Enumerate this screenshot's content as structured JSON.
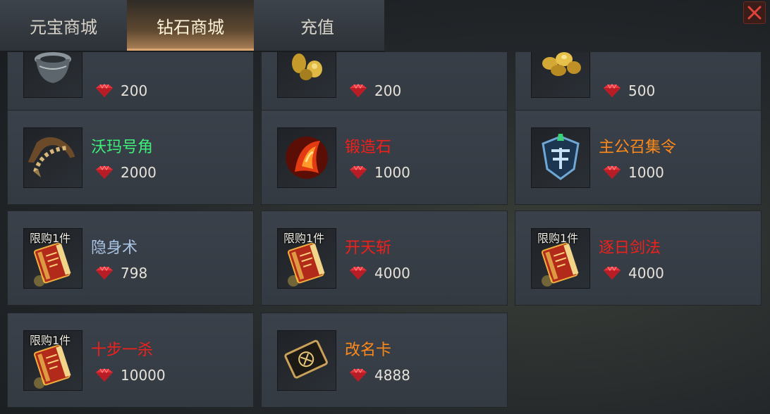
{
  "tabs": [
    {
      "label": "元宝商城",
      "active": false
    },
    {
      "label": "钻石商城",
      "active": true
    },
    {
      "label": "充值",
      "active": false
    }
  ],
  "colors": {
    "green": "#3df07a",
    "red": "#f0201a",
    "orange": "#ff8a1a",
    "blue": "#a9c4e4",
    "gem": "#e8323a"
  },
  "items": [
    {
      "name": "",
      "price": "200",
      "icon": "bronze-cauldron-icon",
      "limit": ""
    },
    {
      "name": "",
      "price": "200",
      "icon": "gold-nuggets-icon",
      "limit": ""
    },
    {
      "name": "",
      "price": "500",
      "icon": "gold-pile-icon",
      "limit": ""
    },
    {
      "name": "沃玛号角",
      "price": "2000",
      "icon": "horn-icon",
      "limit": "",
      "color": "green"
    },
    {
      "name": "锻造石",
      "price": "1000",
      "icon": "forging-stone-icon",
      "limit": "",
      "color": "red"
    },
    {
      "name": "主公召集令",
      "price": "1000",
      "icon": "summon-token-icon",
      "limit": "",
      "color": "orange"
    },
    {
      "name": "隐身术",
      "price": "798",
      "icon": "skill-book-icon",
      "limit": "限购1件",
      "color": "blue"
    },
    {
      "name": "开天斩",
      "price": "4000",
      "icon": "skill-book-icon",
      "limit": "限购1件",
      "color": "red"
    },
    {
      "name": "逐日剑法",
      "price": "4000",
      "icon": "skill-book-icon",
      "limit": "限购1件",
      "color": "red"
    },
    {
      "name": "十步一杀",
      "price": "10000",
      "icon": "skill-book-icon",
      "limit": "限购1件",
      "color": "red"
    },
    {
      "name": "改名卡",
      "price": "4888",
      "icon": "rename-card-icon",
      "limit": "",
      "color": "orange"
    }
  ]
}
